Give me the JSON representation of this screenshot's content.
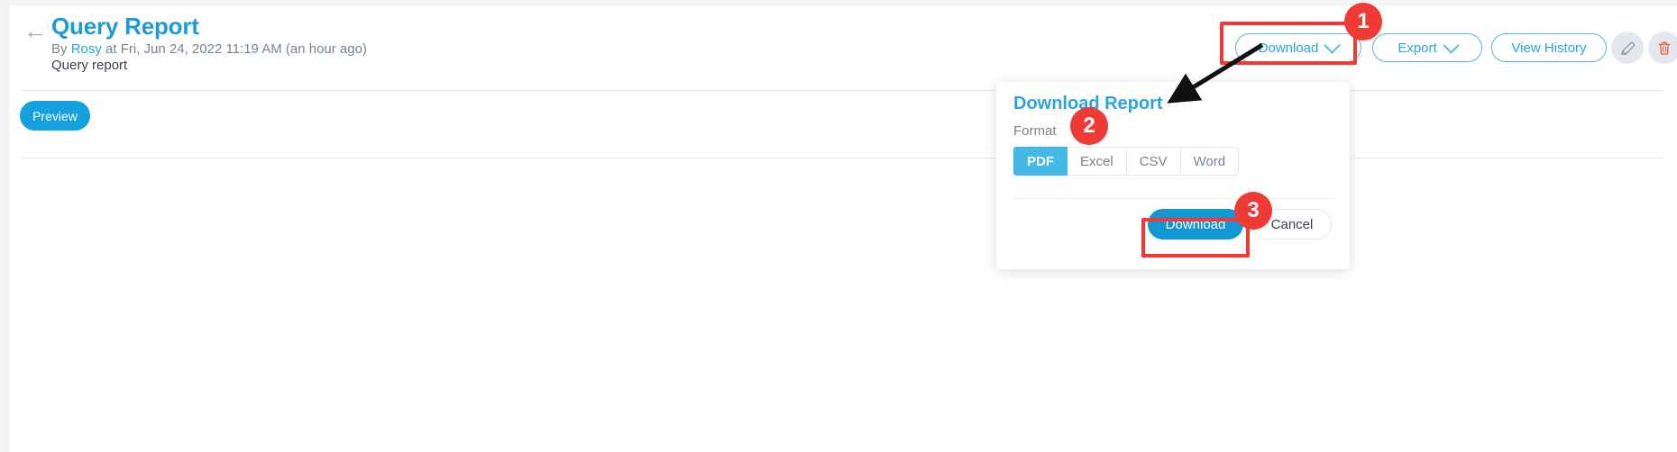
{
  "header": {
    "back_icon": "arrow-left-icon",
    "title": "Query Report",
    "byline_prefix": "By ",
    "byline_author": "Rosy",
    "byline_suffix": " at Fri, Jun 24, 2022 11:19 AM (an hour ago)",
    "subtitle": "Query report",
    "actions": {
      "download_label": "Download",
      "export_label": "Export",
      "view_history_label": "View History",
      "edit_icon": "pencil-icon",
      "delete_icon": "trash-icon"
    }
  },
  "toolbar": {
    "preview_label": "Preview"
  },
  "dialog": {
    "title": "Download Report",
    "format_label": "Format",
    "formats": [
      {
        "label": "PDF",
        "selected": true
      },
      {
        "label": "Excel",
        "selected": false
      },
      {
        "label": "CSV",
        "selected": false
      },
      {
        "label": "Word",
        "selected": false
      }
    ],
    "download_label": "Download",
    "cancel_label": "Cancel"
  },
  "annotations": {
    "badges": [
      "1",
      "2",
      "3"
    ],
    "highlight_color": "#f03a36",
    "arrow_icon": "arrow-pointer-icon"
  },
  "colors": {
    "accent_blue": "#2aa3de",
    "primary_blue": "#14a1dd",
    "segment_active": "#44b8e6",
    "annotation_red": "#f03a36",
    "muted_text": "#76838f",
    "body_text": "#39434d"
  }
}
